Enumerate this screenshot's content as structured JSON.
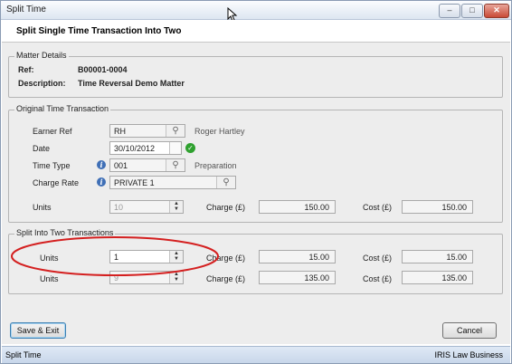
{
  "window": {
    "title": "Split Time",
    "controls": [
      "minimize",
      "maximize",
      "close"
    ],
    "control_glyphs": [
      "‒",
      "□",
      "✕"
    ]
  },
  "header": {
    "title": "Split Single Time Transaction Into Two"
  },
  "matter": {
    "group_title": "Matter Details",
    "ref_label": "Ref:",
    "ref_value": "B00001-0004",
    "desc_label": "Description:",
    "desc_value": "Time Reversal Demo Matter"
  },
  "original": {
    "group_title": "Original Time Transaction",
    "earner_ref_label": "Earner Ref",
    "earner_ref_value": "RH",
    "earner_name": "Roger Hartley",
    "date_label": "Date",
    "date_value": "30/10/2012",
    "time_type_label": "Time Type",
    "time_type_value": "001",
    "time_type_desc": "Preparation",
    "charge_rate_label": "Charge Rate",
    "charge_rate_value": "PRIVATE 1",
    "units_label": "Units",
    "units_value": "10",
    "charge_label": "Charge (£)",
    "charge_value": "150.00",
    "cost_label": "Cost (£)",
    "cost_value": "150.00"
  },
  "split": {
    "group_title": "Split Into Two Transactions",
    "rows": [
      {
        "units_label": "Units",
        "units_value": "1",
        "charge_label": "Charge (£)",
        "charge_value": "15.00",
        "cost_label": "Cost (£)",
        "cost_value": "15.00"
      },
      {
        "units_label": "Units",
        "units_value": "9",
        "charge_label": "Charge (£)",
        "charge_value": "135.00",
        "cost_label": "Cost (£)",
        "cost_value": "135.00"
      }
    ]
  },
  "buttons": {
    "save_exit": "Save & Exit",
    "cancel": "Cancel"
  },
  "status": {
    "left": "Split Time",
    "right": "IRIS Law Business"
  },
  "colors": {
    "highlight_ellipse": "#d42020",
    "status_bar": "#c8d7ea",
    "accent": "#3f6fb6",
    "ok_check": "#2fa12f"
  },
  "icons": {
    "lookup": "magnifier-icon",
    "info": "info-icon",
    "valid": "check-icon"
  }
}
